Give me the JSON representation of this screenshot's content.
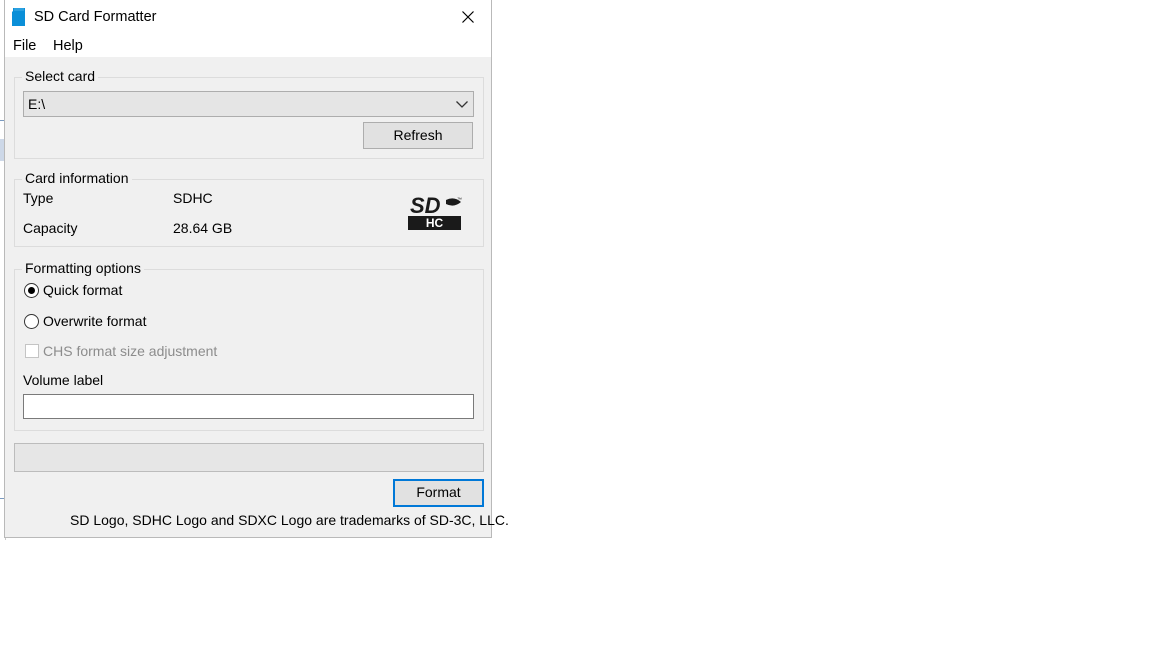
{
  "window": {
    "title": "SD Card Formatter",
    "icon": "sd-card-icon",
    "close_icon": "close-icon",
    "accent_color": "#0078d7",
    "icon_color": "#0a8fd8"
  },
  "menu": [
    {
      "label": "File"
    },
    {
      "label": "Help"
    }
  ],
  "select_card": {
    "legend": "Select card",
    "selected": "E:\\",
    "refresh_label": "Refresh"
  },
  "card_info": {
    "legend": "Card information",
    "rows": [
      {
        "label": "Type",
        "value": "SDHC"
      },
      {
        "label": "Capacity",
        "value": "28.64 GB"
      }
    ],
    "logo": "sdhc-logo"
  },
  "formatting": {
    "legend": "Formatting options",
    "quick_format": {
      "label": "Quick format",
      "checked": true
    },
    "overwrite_format": {
      "label": "Overwrite format",
      "checked": false
    },
    "chs": {
      "label": "CHS format size adjustment",
      "checked": false,
      "disabled": true
    },
    "volume_label": {
      "label": "Volume label",
      "value": ""
    }
  },
  "progress": {
    "value": 0
  },
  "actions": {
    "format_label": "Format"
  },
  "footer": "SD Logo, SDHC Logo and SDXC Logo are trademarks of SD-3C, LLC."
}
